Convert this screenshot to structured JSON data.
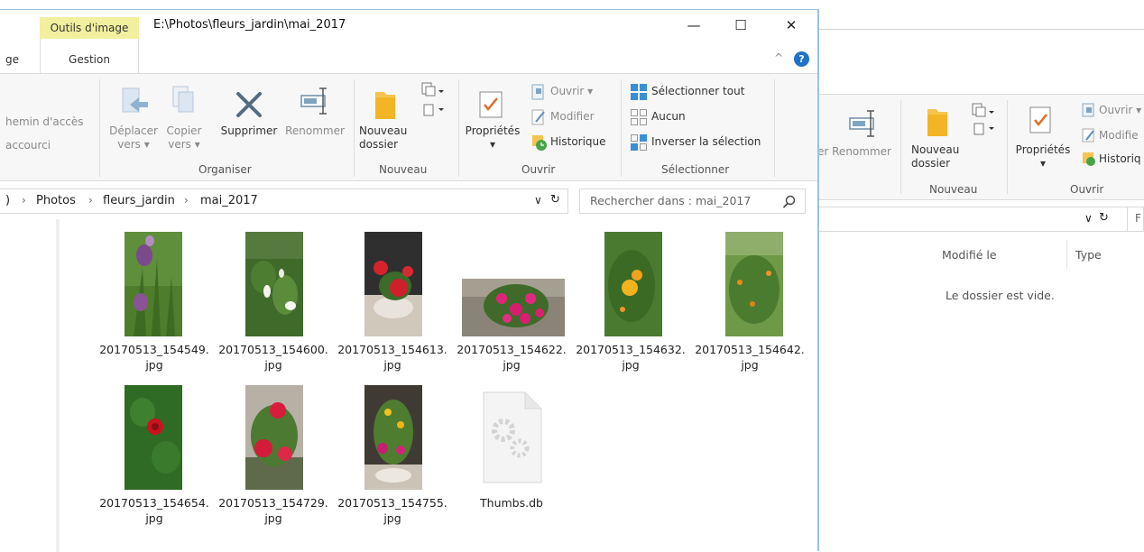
{
  "window": {
    "title_path": "E:\\Photos\\fleurs_jardin\\mai_2017",
    "contextual_tab": "Outils d'image",
    "tab_partial": "ge",
    "tab_gestion": "Gestion",
    "controls": {
      "minimize": "—",
      "maximize": "☐",
      "close": "✕",
      "collapse": "^",
      "help": "?"
    }
  },
  "ribbon": {
    "partial_line1": "hemin d'accès",
    "partial_line2": "accourci",
    "organiser": {
      "label": "Organiser",
      "deplacer": [
        "Déplacer",
        "vers ▾"
      ],
      "copier": [
        "Copier",
        "vers ▾"
      ],
      "supprimer": "Supprimer",
      "renommer": "Renommer"
    },
    "nouveau": {
      "label": "Nouveau",
      "nouveau_dossier": [
        "Nouveau",
        "dossier"
      ]
    },
    "ouvrir": {
      "label": "Ouvrir",
      "proprietes": "Propriétés",
      "proprietes_arrow": "▾",
      "ouvrir": "Ouvrir ▾",
      "modifier": "Modifier",
      "historique": "Historique"
    },
    "selectionner": {
      "label": "Sélectionner",
      "tout": "Sélectionner tout",
      "aucun": "Aucun",
      "inverser": "Inverser la sélection"
    }
  },
  "address": {
    "prefix": ")",
    "crumbs": [
      "Photos",
      "fleurs_jardin",
      "mai_2017"
    ],
    "sep": "›",
    "dropdown": "∨",
    "refresh": "↻",
    "search_placeholder": "Rechercher dans : mai_2017"
  },
  "files": [
    {
      "line1": "20170513_154549.",
      "line2": "jpg"
    },
    {
      "line1": "20170513_154600.",
      "line2": "jpg"
    },
    {
      "line1": "20170513_154613.",
      "line2": "jpg"
    },
    {
      "line1": "20170513_154622.",
      "line2": "jpg"
    },
    {
      "line1": "20170513_154632.",
      "line2": "jpg"
    },
    {
      "line1": "20170513_154642.",
      "line2": "jpg"
    },
    {
      "line1": "20170513_154654.",
      "line2": "jpg"
    },
    {
      "line1": "20170513_154729.",
      "line2": "jpg"
    },
    {
      "line1": "20170513_154755.",
      "line2": "jpg"
    },
    {
      "line1": "Thumbs.db",
      "line2": ""
    }
  ],
  "bg_window": {
    "renommer_partial": "er Renommer",
    "nouveau_dossier": [
      "Nouveau",
      "dossier"
    ],
    "nouveau_label": "Nouveau",
    "proprietes": "Propriétés",
    "proprietes_arrow": "▾",
    "ouvrir": "Ouvrir ▾",
    "modifier": "Modifie",
    "historique": "Historiq",
    "ouvrir_label": "Ouvrir",
    "dropdown": "∨",
    "refresh": "↻",
    "search_partial": "F",
    "col_modified": "Modifié le",
    "col_type": "Type",
    "empty": "Le dossier est vide."
  },
  "colors": {
    "accent": "#3a8fd6",
    "contextual_tab": "#f2ef9e",
    "ribbon_bg": "#f7f7f7",
    "window_border": "#9fc2db"
  }
}
